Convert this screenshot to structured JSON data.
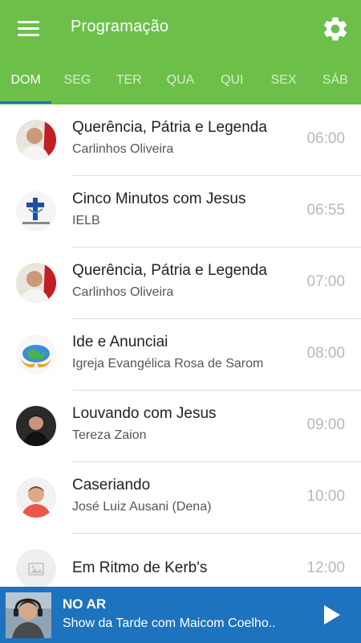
{
  "header": {
    "title": "Programação",
    "menu_icon": "hamburger-menu-icon",
    "settings_icon": "gear-icon"
  },
  "tabs": [
    {
      "label": "DOM",
      "active": true
    },
    {
      "label": "SEG",
      "active": false
    },
    {
      "label": "TER",
      "active": false
    },
    {
      "label": "QUA",
      "active": false
    },
    {
      "label": "QUI",
      "active": false
    },
    {
      "label": "SEX",
      "active": false
    },
    {
      "label": "SÁB",
      "active": false
    }
  ],
  "programs": [
    {
      "name": "Querência, Pátria e Legenda",
      "host": "Carlinhos Oliveira",
      "time": "06:00"
    },
    {
      "name": "Cinco Minutos com Jesus",
      "host": "IELB",
      "time": "06:55"
    },
    {
      "name": "Querência, Pátria e Legenda",
      "host": "Carlinhos Oliveira",
      "time": "07:00"
    },
    {
      "name": "Ide e Anunciai",
      "host": "Igreja Evangélica Rosa de Sarom",
      "time": "08:00"
    },
    {
      "name": "Louvando com Jesus",
      "host": "Tereza Zaion",
      "time": "09:00"
    },
    {
      "name": "Caseriando",
      "host": "José Luiz Ausani (Dena)",
      "time": "10:00"
    },
    {
      "name": "Em Ritmo de Kerb's",
      "host": "",
      "time": "12:00"
    }
  ],
  "player": {
    "label": "NO AR",
    "show": "Show da Tarde com Maicom Coelho..",
    "play_icon": "play-icon"
  },
  "colors": {
    "appbar": "#6cc04a",
    "player": "#1e73be",
    "tab_indicator": "#1e73be"
  }
}
